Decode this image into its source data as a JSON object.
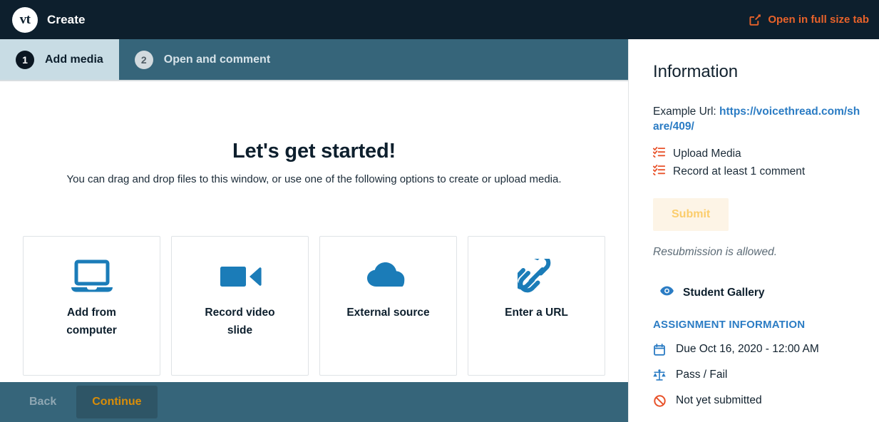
{
  "header": {
    "logo_text": "vt",
    "title": "Create",
    "fullsize_link": "Open in full size tab",
    "accent_color": "#e8622a",
    "background_color": "#0d1f2d"
  },
  "tabs": {
    "items": [
      {
        "number": "1",
        "label": "Add media",
        "active": true
      },
      {
        "number": "2",
        "label": "Open and comment",
        "active": false
      }
    ],
    "bar_color": "#36657a",
    "active_color": "#c8dce4"
  },
  "main": {
    "hero_title": "Let's get started!",
    "hero_subtitle": "You can drag and drop files to this window, or use one of the following options to create or upload media.",
    "options": [
      {
        "icon": "laptop-icon",
        "label": "Add from computer"
      },
      {
        "icon": "video-camera-icon",
        "label": "Record video slide"
      },
      {
        "icon": "cloud-icon",
        "label": "External source"
      },
      {
        "icon": "link-chain-icon",
        "label": "Enter a URL"
      }
    ],
    "icon_color": "#1b7cb8"
  },
  "footer": {
    "back_label": "Back",
    "continue_label": "Continue",
    "continue_color": "#d98d08"
  },
  "info": {
    "title": "Information",
    "example_url_label": "Example Url:",
    "example_url": "https://voicethread.com/share/409/",
    "requirements": [
      {
        "icon": "list-check-icon",
        "label": "Upload Media"
      },
      {
        "icon": "list-check-icon",
        "label": "Record at least 1 comment"
      }
    ],
    "submit_label": "Submit",
    "resubmission_note": "Resubmission is allowed.",
    "gallery": {
      "icon": "eye-icon",
      "label": "Student Gallery"
    },
    "assignment_heading": "ASSIGNMENT INFORMATION",
    "assignment_items": [
      {
        "icon": "calendar-icon",
        "label": "Due Oct 16, 2020 - 12:00 AM"
      },
      {
        "icon": "balance-scale-icon",
        "label": "Pass / Fail"
      },
      {
        "icon": "ban-icon",
        "label": "Not yet submitted"
      }
    ],
    "link_color": "#2b7cc4"
  }
}
